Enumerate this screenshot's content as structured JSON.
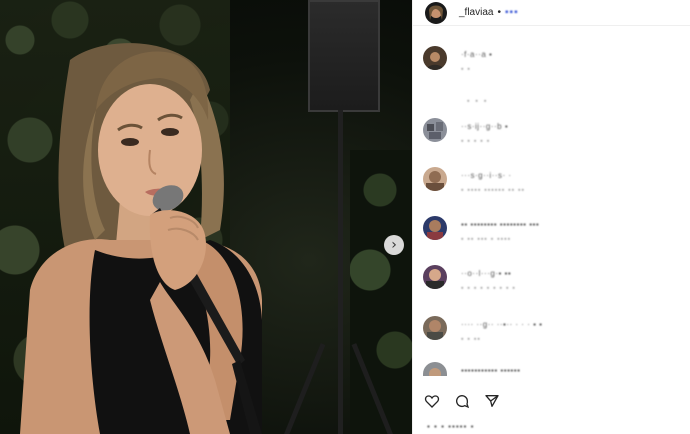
{
  "header": {
    "username": "_flaviaa",
    "separator": "•",
    "follow_label": "▪▪▪"
  },
  "caption": {
    "user": "·f·a··a ▪",
    "meta": "▪ ▪"
  },
  "view_more": "▪ ▪ ▪",
  "comments": [
    {
      "user": "··s·ij··g··b ▪",
      "meta": "▪ ▪ ▪ ▪ ▪"
    },
    {
      "user": "···s·g··i··s· ·",
      "meta": "▪ ▪▪▪▪ ▪▪▪▪▪▪ ▪▪ ▪▪"
    },
    {
      "user": "▪▪ ▪▪▪▪▪▪▪▪ ▪▪▪▪▪▪▪▪ ▪▪▪",
      "meta": "▪ ▪▪ ▪▪▪ ▪ ▪▪▪▪"
    },
    {
      "user": "··o··l···g·▪ ▪▪",
      "meta": "▪ ▪ ▪ ▪ ▪ ▪ ▪ ▪ ▪"
    },
    {
      "user": "···· ··g·· ··▪·· · · · ▪ ▪",
      "meta": "▪ ▪ ▪▪"
    }
  ],
  "partial_comment": {
    "user": "▪▪▪▪▪▪▪▪▪▪▪ ▪▪▪▪▪▪"
  },
  "likes": "▪ ▪ ▪ ▪▪▪▪▪ ▪",
  "icons": {
    "like": "heart-icon",
    "comment": "comment-icon",
    "share": "share-icon",
    "next": "chevron-right-icon"
  },
  "colors": {
    "link": "#3a57d6",
    "text": "#262626",
    "muted": "#a0a0a0"
  }
}
